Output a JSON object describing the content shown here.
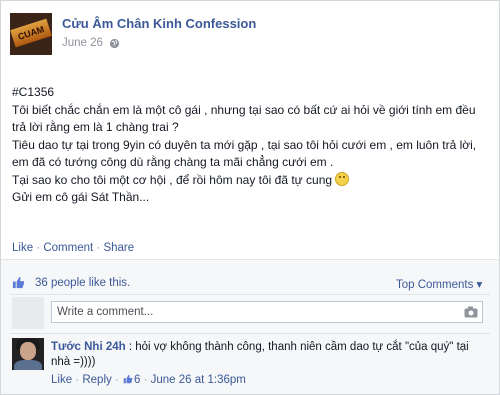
{
  "post": {
    "page_name": "Cửu Âm Chân Kinh Confession",
    "avatar_text": "CUAM",
    "date": "June 26",
    "lines": [
      "#C1356",
      "Tôi biết chắc chắn em là một cô gái , nhưng tại sao có bất cứ ai hỏi về giới tính em đều trả lời rằng em là 1 chàng trai ?",
      "Tiêu dao tự tại trong 9yin có duyên ta mới gặp , tại sao tôi hỏi cưới em , em luôn trả lời, em đã có tướng công dù rằng chàng ta mãi chẳng cưới em .",
      "Tại sao ko cho tôi một cơ hội , để rồi hôm nay tôi đã tự cung",
      "Gửi em cô gái Sát Thần..."
    ]
  },
  "actions": {
    "like": "Like",
    "comment": "Comment",
    "share": "Share",
    "sep": " · "
  },
  "likes": {
    "text": "36 people like this."
  },
  "top_comments": {
    "label": "Top Comments ▾"
  },
  "comment_box": {
    "placeholder": "Write a comment..."
  },
  "comment": {
    "author": "Tước Nhi 24h",
    "text": ": hỏi vợ không thành công, thanh niên cầm dao tự cắt \"của quý\" tại nhà =))))",
    "like": "Like",
    "reply": "Reply",
    "like_count": "6",
    "time": "June 26 at 1:36pm"
  },
  "colors": {
    "link": "#3b5998",
    "text": "#141823",
    "muted": "#90949c"
  }
}
